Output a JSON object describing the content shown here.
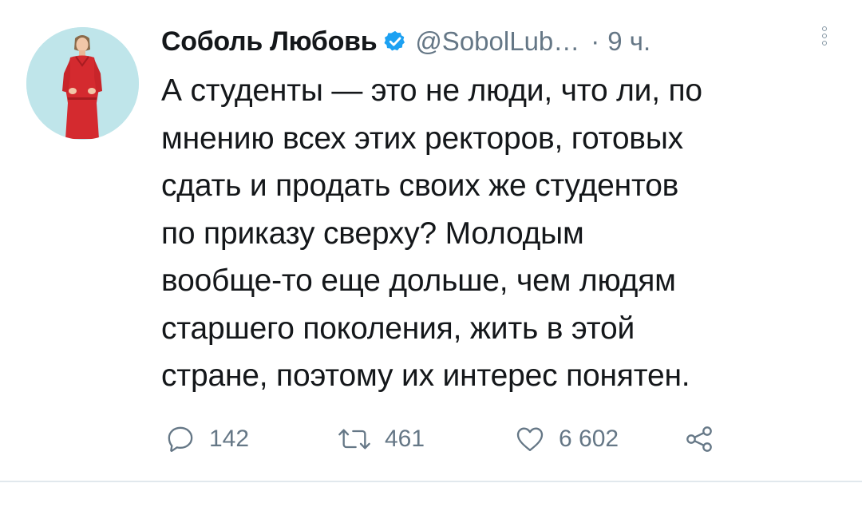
{
  "tweet": {
    "author": {
      "display_name": "Соболь Любовь",
      "verified": true,
      "verified_icon": "verified-badge-icon",
      "handle": "@SobolLub…",
      "avatar_icon": "profile-avatar"
    },
    "separator": "·",
    "timestamp": "9 ч.",
    "more_icon": "vertical-ellipsis-icon",
    "text_lines": [
      "А студенты — это не люди, что ли, по",
      "мнению всех этих ректоров, готовых",
      "сдать и продать своих же студентов",
      "по приказу сверху? Молодым",
      "вообще-то еще дольше, чем людям",
      "старшего поколения, жить в этой",
      "стране, поэтому их интерес понятен."
    ],
    "actions": {
      "reply": {
        "icon": "reply-icon",
        "count": "142"
      },
      "retweet": {
        "icon": "retweet-icon",
        "count": "461"
      },
      "like": {
        "icon": "heart-icon",
        "count": "6 602"
      },
      "share": {
        "icon": "share-icon"
      }
    }
  },
  "colors": {
    "text_primary": "#14171a",
    "text_secondary": "#657786",
    "verified_blue": "#1da1f2",
    "avatar_bg": "#bfe5ea",
    "dress_red": "#d42a2f",
    "divider": "#e1e8ed"
  }
}
